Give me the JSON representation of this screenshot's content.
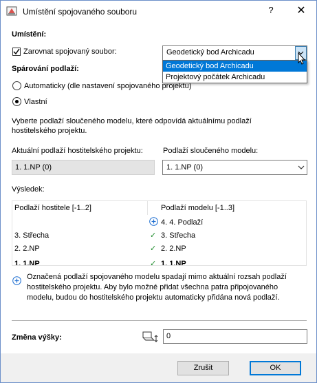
{
  "window": {
    "title": "Umístění spojovaného souboru",
    "help_label": "?",
    "close_label": "✕"
  },
  "placement": {
    "heading": "Umístění:",
    "align_checkbox_label": "Zarovnat spojovaný soubor:",
    "align_checked": true,
    "align_selected": "Geodetický bod Archicadu",
    "align_options": [
      "Geodetický bod Archicadu",
      "Projektový počátek Archicadu"
    ]
  },
  "story_mapping": {
    "heading": "Spárování podlaží:",
    "radio_auto_label": "Automaticky (dle nastavení spojovaného projektu)",
    "radio_custom_label": "Vlastní",
    "selected": "custom",
    "instruction_line1": "Vyberte podlaží sloučeného modelu, které odpovídá aktuálnímu podlaží",
    "instruction_line2": "hostitelského projektu.",
    "host_label": "Aktuální podlaží hostitelského projektu:",
    "host_value": "1. 1.NP (0)",
    "merged_label": "Podlaží sloučeného modelu:",
    "merged_value": "1. 1.NP (0)"
  },
  "result": {
    "heading": "Výsledek:",
    "col_host": "Podlaží hostitele [-1..2]",
    "col_model": "Podlaží modelu [-1..3]",
    "rows": [
      {
        "host": "",
        "status": "added",
        "model": "4. 4. Podlaží"
      },
      {
        "host": "3. Střecha",
        "status": "match",
        "model": "3. Střecha"
      },
      {
        "host": "2. 2.NP",
        "status": "match",
        "model": "2. 2.NP"
      },
      {
        "host": "1. 1.NP",
        "status": "match",
        "model": "1. 1.NP"
      }
    ],
    "check_glyph": "✓",
    "scroll_up": "⌃",
    "scroll_down": "⌄"
  },
  "notice": {
    "line1": "Označená podlaží spojovaného modelu spadají mimo aktuální rozsah podlaží",
    "line2": "hostitelského projektu. Aby bylo možné přidat všechna patra připojovaného",
    "line3": "modelu, budou do hostitelského projektu automaticky přidána nová podlaží."
  },
  "elevation": {
    "label": "Změna výšky:",
    "value": "0"
  },
  "buttons": {
    "cancel": "Zrušit",
    "ok": "OK"
  },
  "colors": {
    "accent": "#0078d7",
    "check": "#1a8a28",
    "plus_icon": "#1f6fd1"
  }
}
